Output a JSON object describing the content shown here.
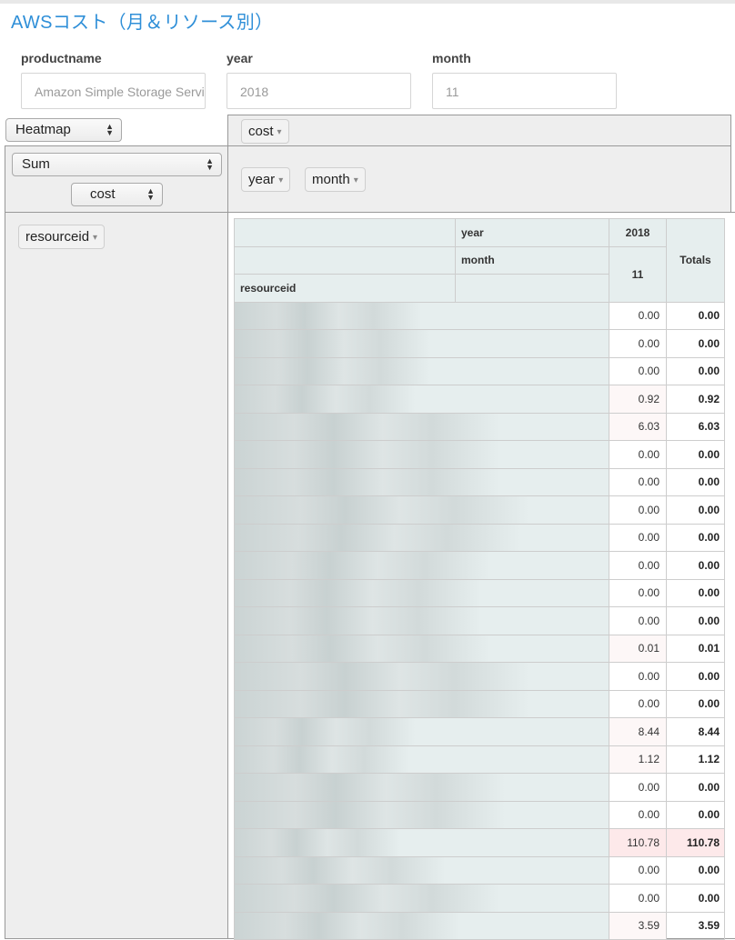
{
  "title": "AWSコスト（月＆リソース別）",
  "filters": [
    {
      "label": "productname",
      "value": "Amazon Simple Storage Service"
    },
    {
      "label": "year",
      "value": "2018"
    },
    {
      "label": "month",
      "value": "11"
    }
  ],
  "renderer": {
    "selected": "Heatmap"
  },
  "aggregator": {
    "selected": "Sum",
    "field": "cost"
  },
  "unused_attrs": [
    "cost"
  ],
  "col_attrs": [
    "year",
    "month"
  ],
  "row_attrs": [
    "resourceid"
  ],
  "table": {
    "col_header_year_label": "year",
    "col_header_month_label": "month",
    "row_header_label": "resourceid",
    "year_value": "2018",
    "month_value": "11",
    "totals_label": "Totals",
    "rows": [
      {
        "value": "0.00",
        "total": "0.00",
        "blur": 0.62
      },
      {
        "value": "0.00",
        "total": "0.00",
        "blur": 0.65
      },
      {
        "value": "0.00",
        "total": "0.00",
        "blur": 0.65
      },
      {
        "value": "0.92",
        "total": "0.92",
        "blur": 0.6
      },
      {
        "value": "6.03",
        "total": "6.03",
        "blur": 0.88
      },
      {
        "value": "0.00",
        "total": "0.00",
        "blur": 0.88
      },
      {
        "value": "0.00",
        "total": "0.00",
        "blur": 0.88
      },
      {
        "value": "0.00",
        "total": "0.00",
        "blur": 0.98
      },
      {
        "value": "0.00",
        "total": "0.00",
        "blur": 0.95
      },
      {
        "value": "0.00",
        "total": "0.00",
        "blur": 0.85
      },
      {
        "value": "0.00",
        "total": "0.00",
        "blur": 0.82
      },
      {
        "value": "0.00",
        "total": "0.00",
        "blur": 0.82
      },
      {
        "value": "0.01",
        "total": "0.01",
        "blur": 0.85
      },
      {
        "value": "0.00",
        "total": "0.00",
        "blur": 0.98
      },
      {
        "value": "0.00",
        "total": "0.00",
        "blur": 0.98
      },
      {
        "value": "8.44",
        "total": "8.44",
        "blur": 0.6
      },
      {
        "value": "1.12",
        "total": "1.12",
        "blur": 0.58
      },
      {
        "value": "0.00",
        "total": "0.00",
        "blur": 0.9
      },
      {
        "value": "0.00",
        "total": "0.00",
        "blur": 0.9
      },
      {
        "value": "110.78",
        "total": "110.78",
        "blur": 0.55
      },
      {
        "value": "0.00",
        "total": "0.00",
        "blur": 0.7
      },
      {
        "value": "0.00",
        "total": "0.00",
        "blur": 0.88
      },
      {
        "value": "3.59",
        "total": "3.59",
        "blur": 0.75
      }
    ]
  },
  "colors": {
    "title": "#2f8fd8",
    "header_bg": "#e6eeee",
    "heat_max": "#fde9ea",
    "heat_low": "#fdf7f7",
    "panel_bg": "#eeeeee"
  }
}
